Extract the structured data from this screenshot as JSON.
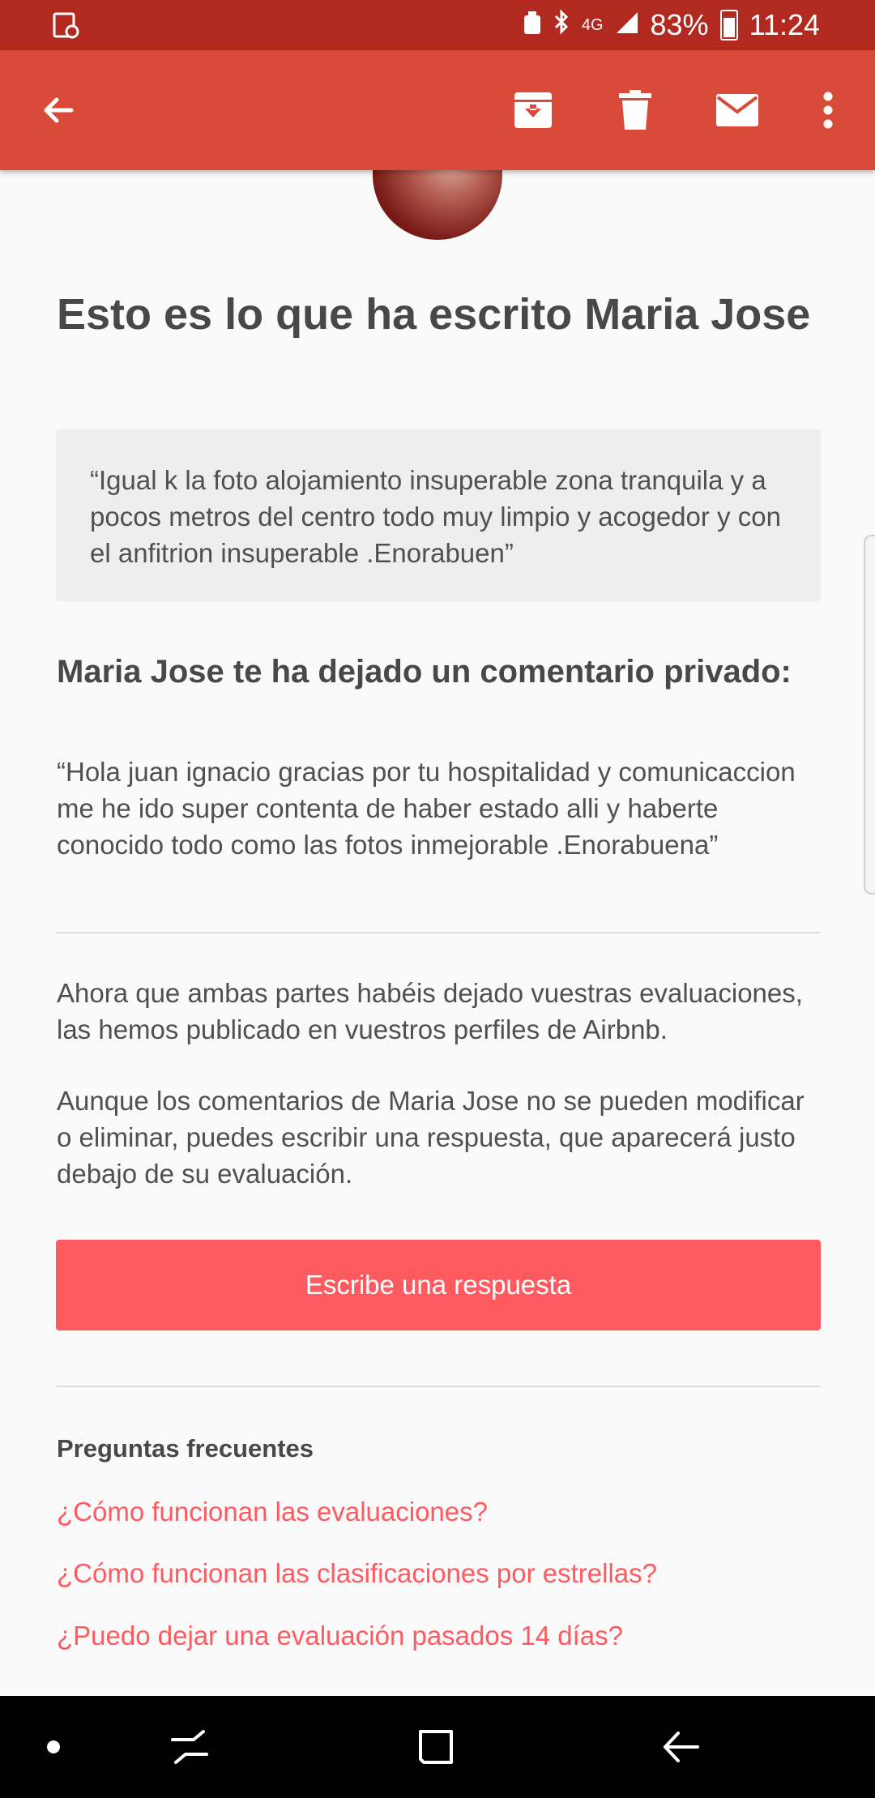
{
  "status_bar": {
    "network": "4G",
    "battery": "83%",
    "time": "11:24"
  },
  "app_bar": {
    "icons": [
      "back-arrow-icon",
      "archive-icon",
      "delete-icon",
      "mail-icon",
      "overflow-menu-icon"
    ]
  },
  "email": {
    "title": "Esto es lo que ha escrito Maria Jose",
    "public_review": "“Igual k la foto alojamiento insuperable zona tranquila y a pocos metros del centro todo muy limpio y acogedor y con el anfitrion insuperable .Enorabuen”",
    "private_heading": "Maria Jose te ha dejado un comentario privado:",
    "private_comment": "“Hola juan ignacio gracias por tu hospitalidad y comunicaccion me he ido super contenta de haber estado alli y haberte conocido todo como las fotos inmejorable .Enorabuena”",
    "paragraph_1": "Ahora que ambas partes habéis dejado vuestras evaluaciones, las hemos publicado en vuestros perfiles de Airbnb.",
    "paragraph_2": "Aunque los comentarios de Maria Jose no se pueden modificar o eliminar, puedes escribir una respuesta, que aparecerá justo debajo de su evaluación.",
    "reply_button": "Escribe una respuesta",
    "faq": {
      "heading": "Preguntas frecuentes",
      "links": [
        "¿Cómo funcionan las evaluaciones?",
        "¿Cómo funcionan las clasificaciones por estrellas?",
        "¿Puedo dejar una evaluación pasados 14 días?"
      ]
    }
  },
  "colors": {
    "status_bar": "#b1291f",
    "app_bar": "#d94a38",
    "accent": "#ff5a5f",
    "text": "#484848"
  }
}
